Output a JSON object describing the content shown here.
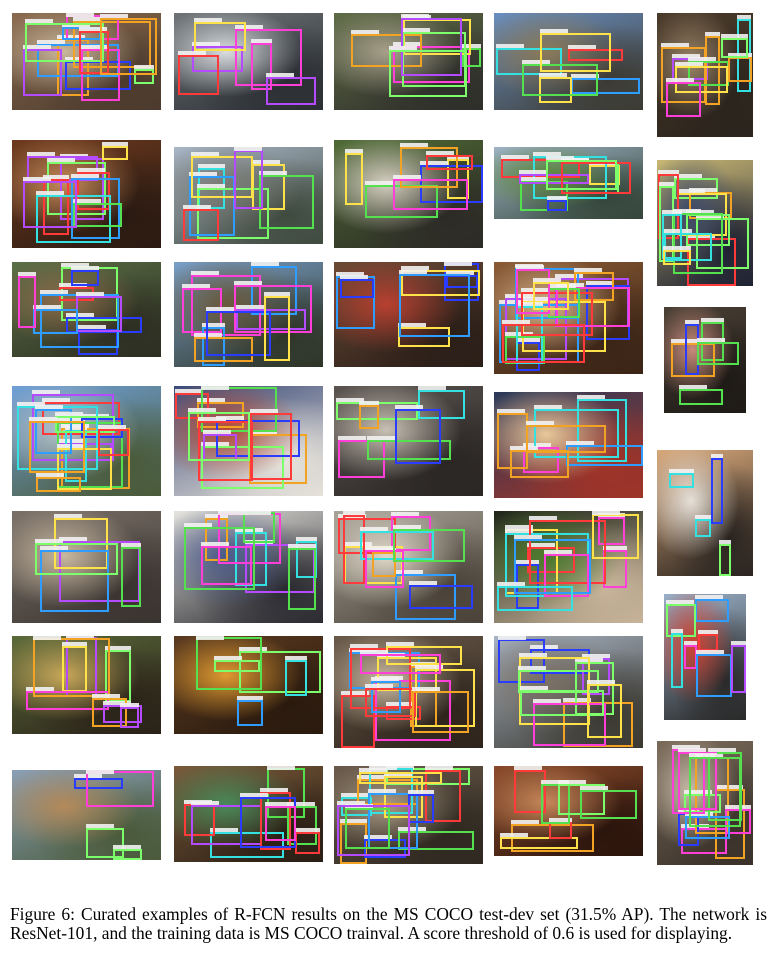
{
  "figure": {
    "caption": "Figure 6: Curated examples of R-FCN results on the MS COCO test-dev set (31.5% AP). The network is ResNet-101, and the training data is MS COCO trainval. A score threshold of 0.6 is used for displaying."
  },
  "box_colors": [
    "#2a3cff",
    "#55e050",
    "#f2a323",
    "#ff3fd8",
    "#35e0e0",
    "#b44bff",
    "#ffe24a",
    "#ff3a3a",
    "#7cff6a",
    "#2f9dff"
  ],
  "photos": [
    {
      "name": "living-room-people",
      "palette": [
        "#8a6a4e",
        "#c9b79c",
        "#4b3a2d"
      ],
      "boxes": 12
    },
    {
      "name": "whitewater-kayak",
      "palette": [
        "#6f7478",
        "#d9dde0",
        "#2b2f33"
      ],
      "boxes": 6
    },
    {
      "name": "man-on-motorbike",
      "palette": [
        "#5e6b46",
        "#a7a08a",
        "#2e2e2a"
      ],
      "boxes": 7
    },
    {
      "name": "child-on-bench",
      "palette": [
        "#6a8fc0",
        "#8b7a58",
        "#3c3a32"
      ],
      "boxes": 6
    },
    {
      "name": "kitchen-table",
      "palette": [
        "#4a3a2a",
        "#9a8468",
        "#2b241d"
      ],
      "boxes": 9
    },
    {
      "name": "woman-with-bottles",
      "palette": [
        "#6e3a1e",
        "#c48a5a",
        "#2a1a12"
      ],
      "boxes": 10
    },
    {
      "name": "road-with-cars",
      "palette": [
        "#a9b7c8",
        "#7a7a74",
        "#3f4a3e"
      ],
      "boxes": 8
    },
    {
      "name": "family-with-cow",
      "palette": [
        "#4e6a34",
        "#d6cfc2",
        "#2c2a26"
      ],
      "boxes": 7
    },
    {
      "name": "sheep-on-field",
      "palette": [
        "#9eb4c6",
        "#5f8a3c",
        "#34463a"
      ],
      "boxes": 9
    },
    {
      "name": "tv-shop-wall",
      "palette": [
        "#c9b874",
        "#3c4a6a",
        "#1e2233"
      ],
      "boxes": 12
    },
    {
      "name": "horses-and-riders",
      "palette": [
        "#5a7046",
        "#8c6a4a",
        "#2d2e22"
      ],
      "boxes": 9
    },
    {
      "name": "horses-in-field",
      "palette": [
        "#7aa0c9",
        "#6a5a3c",
        "#2e3426"
      ],
      "boxes": 9
    },
    {
      "name": "man-with-laptop",
      "palette": [
        "#6a4a36",
        "#b84030",
        "#2a1e18"
      ],
      "boxes": 7
    },
    {
      "name": "donuts-on-tray",
      "palette": [
        "#8a5a34",
        "#d8b48a",
        "#3a2416"
      ],
      "boxes": 16
    },
    {
      "name": "kite-and-lamp",
      "palette": [
        "#4a4036",
        "#c88a7a",
        "#1e1a16"
      ],
      "boxes": 5
    },
    {
      "name": "beach-crowd",
      "palette": [
        "#6fa0d8",
        "#b8c4cc",
        "#4a5a38"
      ],
      "boxes": 14
    },
    {
      "name": "tennis-player",
      "palette": [
        "#3a4a78",
        "#b44a34",
        "#e6e2da"
      ],
      "boxes": 10
    },
    {
      "name": "man-at-desk",
      "palette": [
        "#5a5450",
        "#c8c0b4",
        "#2a2624"
      ],
      "boxes": 6
    },
    {
      "name": "pizza-and-drink",
      "palette": [
        "#2a3a5a",
        "#e8c89a",
        "#a03428"
      ],
      "boxes": 7
    },
    {
      "name": "two-women-portrait",
      "palette": [
        "#d8a87a",
        "#e6e0d8",
        "#2a2420"
      ],
      "boxes": 4
    },
    {
      "name": "cat-and-laptop",
      "palette": [
        "#7a7068",
        "#c8b8a0",
        "#3a3430"
      ],
      "boxes": 5
    },
    {
      "name": "group-of-people",
      "palette": [
        "#e6e4de",
        "#4a5a8a",
        "#2a2a30"
      ],
      "boxes": 9
    },
    {
      "name": "woman-at-table",
      "palette": [
        "#a8a49a",
        "#e0d8c8",
        "#4a4238"
      ],
      "boxes": 10
    },
    {
      "name": "broccoli-plate",
      "palette": [
        "#1e2418",
        "#4a7a2a",
        "#c8b49a"
      ],
      "boxes": 11
    },
    {
      "name": "traffic-signs",
      "palette": [
        "#9ab0c8",
        "#d04030",
        "#2a2a2a"
      ],
      "boxes": 7
    },
    {
      "name": "kitchen-counter",
      "palette": [
        "#5a6a3a",
        "#c8a85a",
        "#2a2218"
      ],
      "boxes": 8
    },
    {
      "name": "oranges-in-basket",
      "palette": [
        "#5a3a20",
        "#e09a30",
        "#2a1a0e"
      ],
      "boxes": 5
    },
    {
      "name": "dinner-table",
      "palette": [
        "#6a5a4a",
        "#c8b8a0",
        "#2e241c"
      ],
      "boxes": 13
    },
    {
      "name": "street-with-bus",
      "palette": [
        "#a8b4c4",
        "#7a7064",
        "#3a3830"
      ],
      "boxes": 10
    },
    {
      "name": "giraffes",
      "palette": [
        "#8aa0b8",
        "#b48a5a",
        "#4a5a3a"
      ],
      "boxes": 4
    },
    {
      "name": "dining-room-table",
      "palette": [
        "#7a5a3a",
        "#4a8a5a",
        "#2a1e14"
      ],
      "boxes": 9
    },
    {
      "name": "suitcases",
      "palette": [
        "#6a5a4a",
        "#a89a84",
        "#2e2820"
      ],
      "boxes": 14
    },
    {
      "name": "teddy-bears",
      "palette": [
        "#8a4a2a",
        "#c8885a",
        "#2a140c"
      ],
      "boxes": 7
    },
    {
      "name": "cafe-interior",
      "palette": [
        "#7a6a5a",
        "#c8bca8",
        "#3a322a"
      ],
      "boxes": 11
    }
  ]
}
